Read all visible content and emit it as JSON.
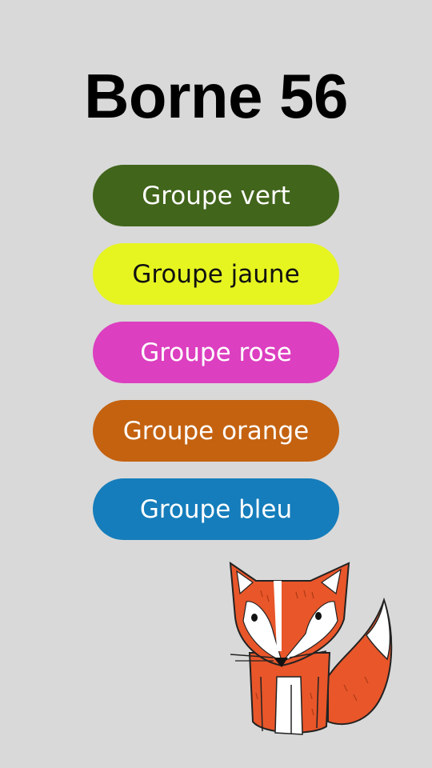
{
  "page": {
    "title": "Borne 56"
  },
  "groups": [
    {
      "label": "Groupe vert",
      "color": "#41651b",
      "text_color": "#ffffff"
    },
    {
      "label": "Groupe jaune",
      "color": "#e6f520",
      "text_color": "#111111"
    },
    {
      "label": "Groupe rose",
      "color": "#dc3fc0",
      "text_color": "#ffffff"
    },
    {
      "label": "Groupe orange",
      "color": "#c46210",
      "text_color": "#ffffff"
    },
    {
      "label": "Groupe bleu",
      "color": "#157dbb",
      "text_color": "#ffffff"
    }
  ],
  "colors": {
    "background": "#d9d9d9",
    "fox_orange": "#e8562a"
  },
  "illustration": {
    "icon": "fox-icon"
  }
}
